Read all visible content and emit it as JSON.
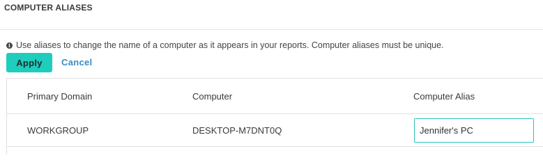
{
  "section": {
    "title": "COMPUTER ALIASES"
  },
  "info": {
    "icon": "info-icon",
    "text": "Use aliases to change the name of a computer as it appears in your reports. Computer aliases must be unique."
  },
  "actions": {
    "apply_label": "Apply",
    "cancel_label": "Cancel"
  },
  "table": {
    "columns": [
      "Primary Domain",
      "Computer",
      "Computer Alias"
    ],
    "rows": [
      {
        "domain": "WORKGROUP",
        "computer": "DESKTOP-M7DNT0Q",
        "alias": "Jennifer's PC"
      }
    ]
  },
  "colors": {
    "accent": "#1fcdbd",
    "link": "#3b8bc4"
  }
}
